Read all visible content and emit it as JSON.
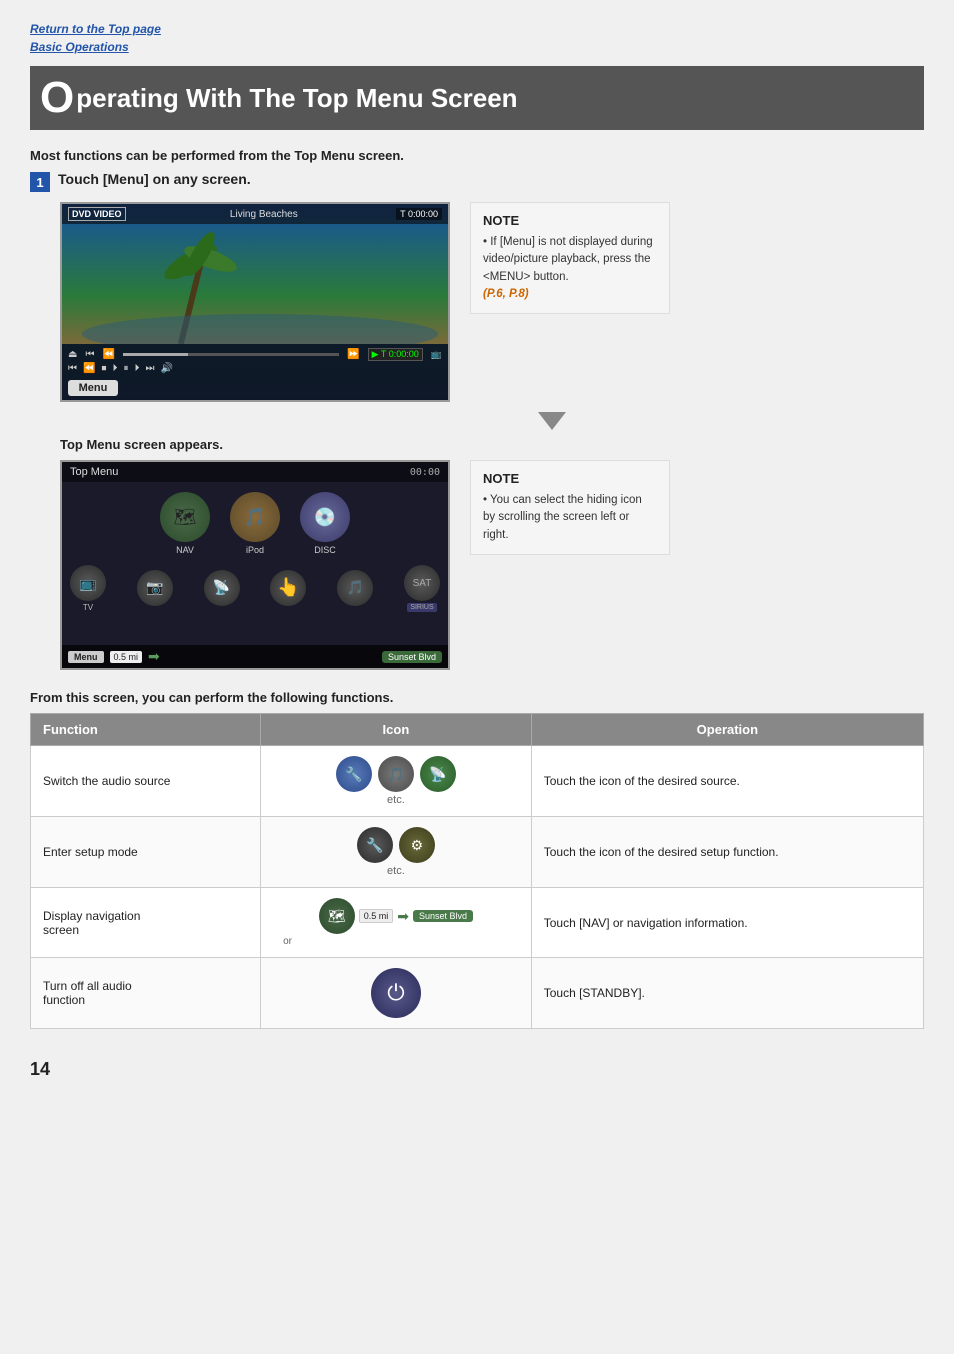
{
  "breadcrumbs": {
    "top_page": "Return to the Top page",
    "basic_ops": "Basic Operations"
  },
  "page_title": {
    "big_letter": "O",
    "rest": "perating With The Top Menu Screen"
  },
  "intro": "Most functions can be performed from the Top Menu screen.",
  "step1": {
    "number": "1",
    "label": "Touch [Menu] on any screen."
  },
  "dvd_screen": {
    "logo": "DVD VIDEO",
    "title": "Living Beaches",
    "time": "T 0:00:00",
    "menu_btn": "Menu"
  },
  "note1": {
    "title": "NOTE",
    "text": "If [Menu] is not displayed during video/picture playback, press the <MENU> button.",
    "link_text": "(P.6, P.8)"
  },
  "top_menu_label": "Top Menu screen appears.",
  "top_menu_screen": {
    "header": "Top Menu",
    "time": "00:00",
    "icons": [
      {
        "label": "NAV"
      },
      {
        "label": "iPod"
      },
      {
        "label": "DISC"
      }
    ],
    "bottom_dist": "0.5 mi",
    "bottom_street": "Sunset Blvd",
    "sirius_label": "SIRIUS"
  },
  "note2": {
    "title": "NOTE",
    "text": "You can select the hiding icon by scrolling the screen left or right."
  },
  "table_intro": "From this screen, you can perform the following functions.",
  "table": {
    "headers": [
      "Function",
      "Icon",
      "Operation"
    ],
    "rows": [
      {
        "function": "Switch the audio source",
        "icon_desc": "audio icons etc.",
        "operation": "Touch the icon of the desired source."
      },
      {
        "function": "Enter setup mode",
        "icon_desc": "setup icons etc.",
        "operation": "Touch the icon of the desired setup function."
      },
      {
        "function_line1": "Display navigation",
        "function_line2": "screen",
        "icon_desc": "nav icon or 0.5 mi arrow Sunset Blvd or",
        "operation": "Touch [NAV] or navigation information."
      },
      {
        "function_line1": "Turn off all audio",
        "function_line2": "function",
        "icon_desc": "power icon",
        "operation": "Touch [STANDBY]."
      }
    ]
  },
  "page_number": "14"
}
